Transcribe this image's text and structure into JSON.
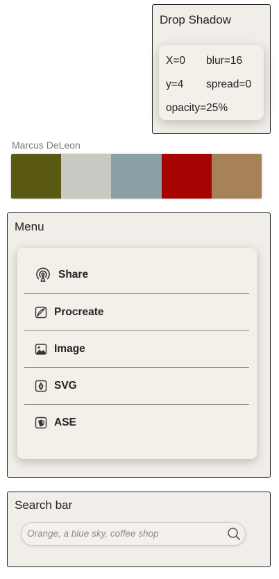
{
  "drop_shadow": {
    "title": "Drop Shadow",
    "x": "X=0",
    "blur": "blur=16",
    "y": "y=4",
    "spread": "spread=0",
    "opacity": "opacity=25%"
  },
  "palette": {
    "author": "Marcus DeLeon",
    "colors": [
      "#5b5a14",
      "#c9c9c3",
      "#89a1a6",
      "#a60303",
      "#a78159"
    ]
  },
  "menu": {
    "title": "Menu",
    "items": [
      {
        "label": "Share",
        "icon": "airdrop-icon"
      },
      {
        "label": "Procreate",
        "icon": "procreate-icon"
      },
      {
        "label": "Image",
        "icon": "image-icon"
      },
      {
        "label": "SVG",
        "icon": "pen-nib-icon"
      },
      {
        "label": "ASE",
        "icon": "swatch-book-icon"
      }
    ]
  },
  "search": {
    "title": "Search bar",
    "placeholder": "Orange, a blue sky, coffee shop",
    "icon": "search-icon"
  }
}
